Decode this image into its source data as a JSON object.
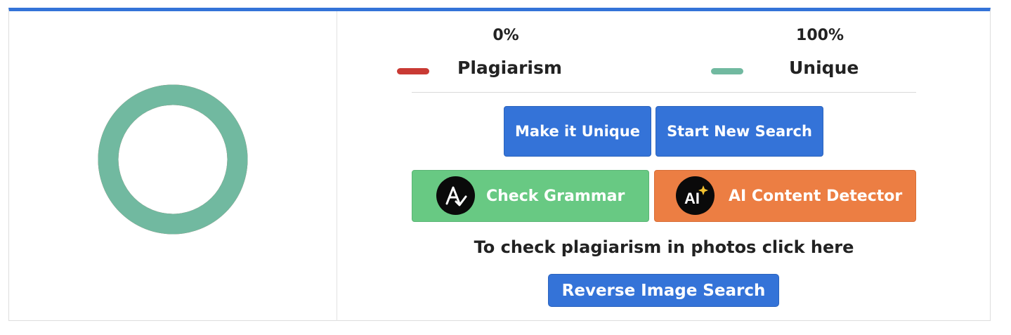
{
  "colors": {
    "accent": "#3473d8",
    "plagiarism": "#c93a34",
    "unique": "#71b9a0",
    "grammar": "#68c983",
    "ai_detector": "#ec7e43"
  },
  "result": {
    "plagiarism_percent": "0%",
    "unique_percent": "100%",
    "plagiarism_label": "Plagiarism",
    "unique_label": "Unique",
    "unique_fraction": 1.0
  },
  "actions": {
    "make_unique": "Make it Unique",
    "start_new_search": "Start New Search",
    "check_grammar": "Check Grammar",
    "ai_content_detector": "AI Content Detector",
    "photo_hint": "To check plagiarism in photos click here",
    "reverse_image_search": "Reverse Image Search"
  },
  "icons": {
    "grammar": "grammar-check-icon",
    "ai": "ai-sparkle-icon"
  }
}
